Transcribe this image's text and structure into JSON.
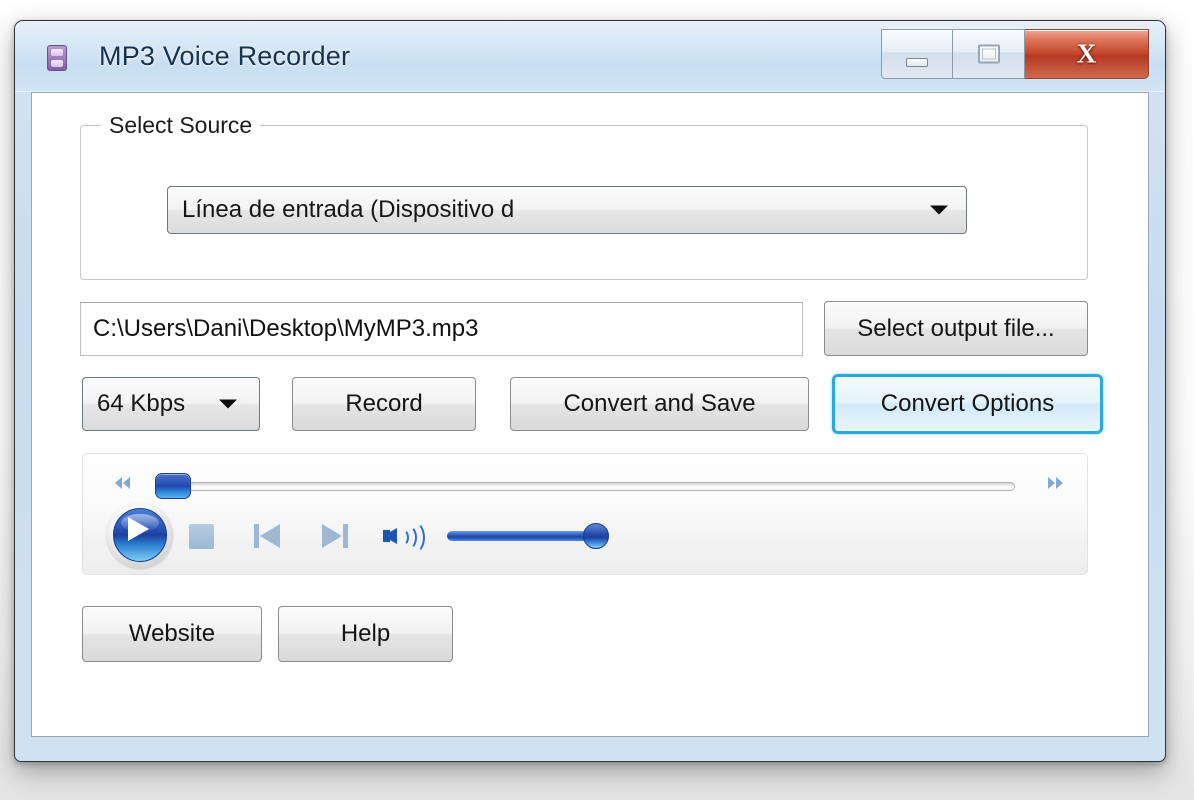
{
  "window": {
    "title": "MP3 Voice Recorder",
    "icon": "recorder-icon",
    "controls": {
      "minimize": "minimize-icon",
      "maximize": "restore-icon",
      "close": "X"
    }
  },
  "source_group": {
    "label": "Select Source",
    "device_combo": {
      "value": "Línea de entrada (Dispositivo d",
      "arrow": "chevron-down-icon"
    }
  },
  "output": {
    "path_value": "C:\\Users\\Dani\\Desktop\\MyMP3.mp3",
    "path_placeholder": "C:\\Users\\Dani\\Desktop\\MyMP3.mp3",
    "select_button": "Select output file..."
  },
  "actions": {
    "bitrate": {
      "value": "64 Kbps",
      "arrow": "chevron-down-icon"
    },
    "record": "Record",
    "convert_and_save": "Convert and Save",
    "convert_options": "Convert Options"
  },
  "player": {
    "rewind_icon": "rewind-icon",
    "forward_icon": "fast-forward-icon",
    "play_icon": "play-icon",
    "stop_icon": "stop-icon",
    "previous_icon": "previous-track-icon",
    "next_icon": "next-track-icon",
    "volume_icon": "speaker-icon",
    "seek_position_percent": 1,
    "volume_percent": 92
  },
  "footer": {
    "website": "Website",
    "help": "Help"
  },
  "colors": {
    "accent_focus": "#2aa9e0",
    "title_text": "#16334f",
    "close_button": "#c2442a",
    "player_blue": "#1c3f9e"
  }
}
